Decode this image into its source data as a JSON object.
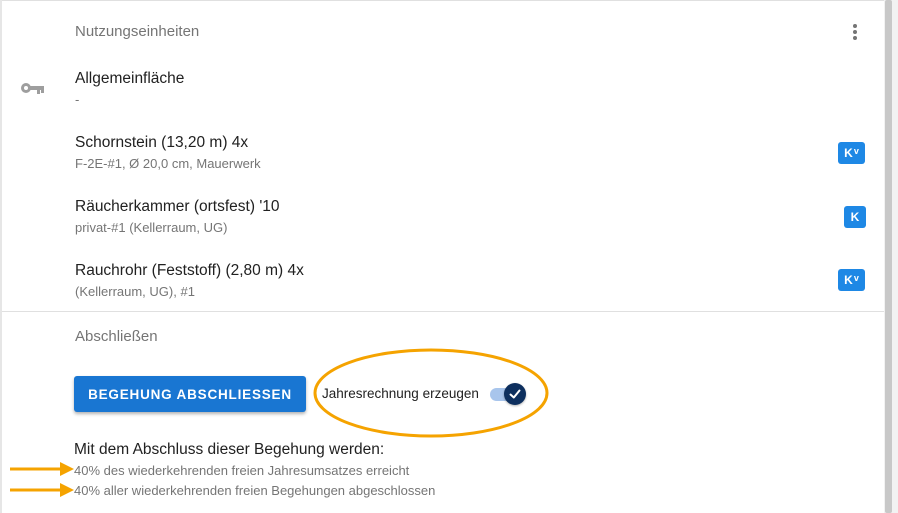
{
  "units_section": {
    "title": "Nutzungseinheiten",
    "menu_icon": "more-vert-icon",
    "items": [
      {
        "icon": "key-icon",
        "title": "Allgemeinfläche",
        "subtitle": "-"
      }
    ]
  },
  "objects": [
    {
      "title": "Schornstein (13,20 m) 4x",
      "subtitle": "F-2E-#1, Ø 20,0 cm, Mauerwerk",
      "badge": "K",
      "badge_sup": "v"
    },
    {
      "title": "Räucherkammer (ortsfest) '10",
      "subtitle": "privat-#1 (Kellerraum, UG)",
      "badge": "K",
      "badge_sup": ""
    },
    {
      "title": "Rauchrohr (Feststoff) (2,80 m) 4x",
      "subtitle": "(Kellerraum, UG), #1",
      "badge": "K",
      "badge_sup": "v"
    }
  ],
  "finish_section": {
    "title": "Abschließen",
    "button_label": "BEGEHUNG ABSCHLIESSEN",
    "toggle_label": "Jahresrechnung erzeugen",
    "toggle_checked": true,
    "info_heading": "Mit dem Abschluss dieser Begehung werden:",
    "info_lines": [
      "40% des wiederkehrenden freien Jahresumsatzes erreicht",
      "40% aller wiederkehrenden freien Begehungen abgeschlossen"
    ]
  },
  "colors": {
    "primary": "#1976d2",
    "badge": "#1e88e5",
    "toggle_knob": "#0d2f5e",
    "annotation": "#f5a300"
  }
}
